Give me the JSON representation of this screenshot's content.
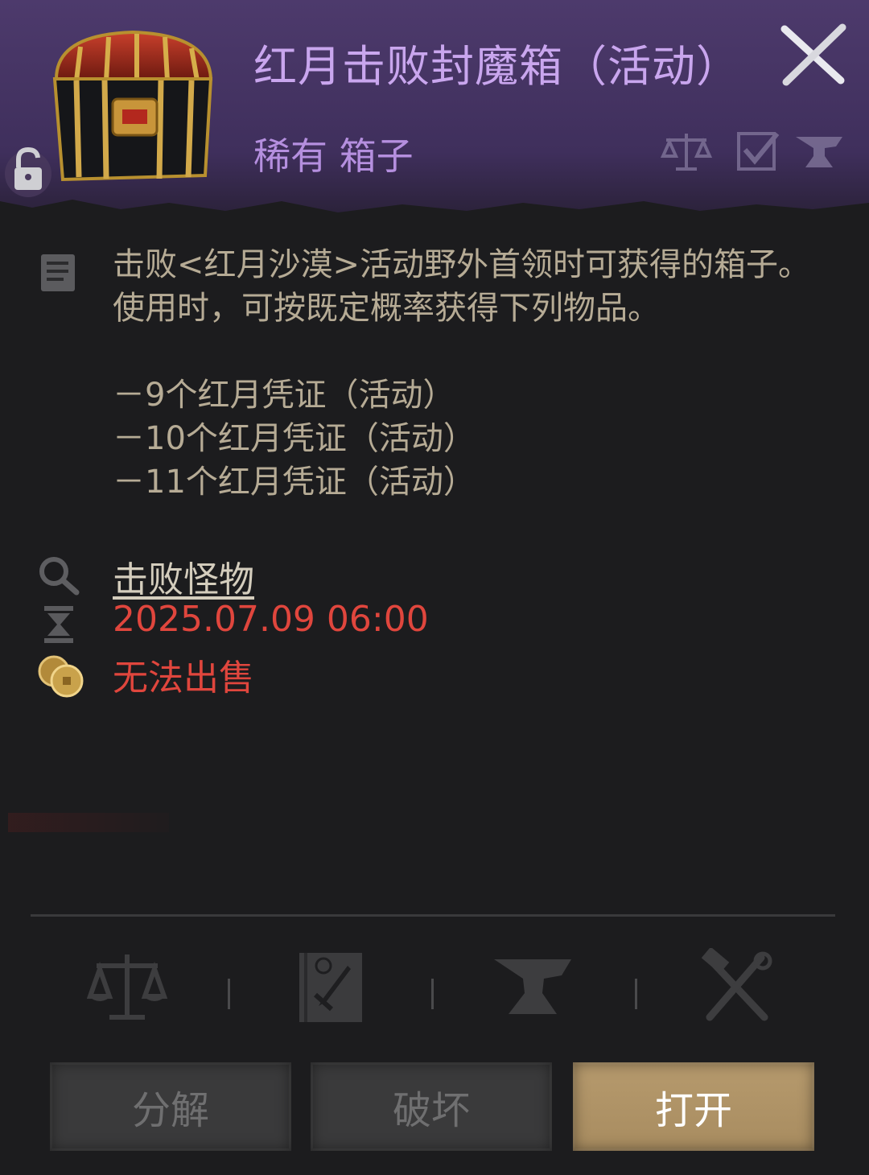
{
  "header": {
    "title": "红月击败封魔箱（活动）",
    "subtitle": "稀有 箱子",
    "icons": [
      "chest-image",
      "lock-open-icon",
      "close-icon",
      "scale-icon",
      "checkbox-icon",
      "anvil-icon"
    ]
  },
  "description": {
    "text": "击败<红月沙漠>活动野外首领时可获得的箱子。\n使用时，可按既定概率获得下列物品。\n\n－9个红月凭证（活动）\n－10个红月凭证（活动）\n－11个红月凭证（活动）"
  },
  "source": {
    "label": "击败怪物"
  },
  "expiry": {
    "value": "2025.07.09 06:00"
  },
  "sell": {
    "value": "无法出售"
  },
  "tools": [
    "scale-icon",
    "book-sword-icon",
    "anvil-icon",
    "hammer-tongs-icon"
  ],
  "buttons": {
    "disassemble": "分解",
    "destroy": "破坏",
    "open": "打开"
  },
  "colors": {
    "header_bg": "#4d3a6c",
    "title": "#c9a6ee",
    "body_bg": "#1c1c1e",
    "text": "#b6ab95",
    "warning": "#e0463d",
    "open_button": "#b69a6d"
  }
}
